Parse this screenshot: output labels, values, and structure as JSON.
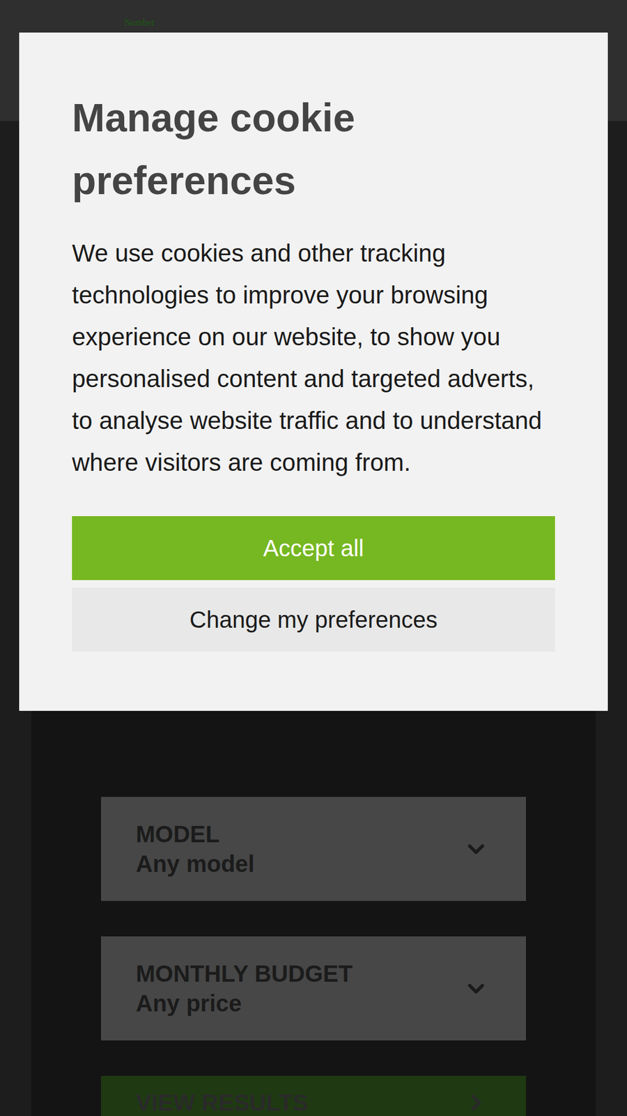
{
  "header": {
    "logo_text": "Number"
  },
  "cookie_dialog": {
    "title": "Manage cookie preferences",
    "body": "We use cookies and other tracking technologies to improve your browsing experience on our website, to show you personalised content and targeted adverts, to analyse website traffic and to understand where visitors are coming from.",
    "buttons": [
      {
        "label": "Accept all",
        "kind": "primary"
      },
      {
        "label": "Change my preferences",
        "kind": "secondary"
      }
    ]
  },
  "search_form": {
    "fields": [
      {
        "label": "MODEL",
        "value": "Any model"
      },
      {
        "label": "MONTHLY BUDGET",
        "value": "Any price"
      }
    ],
    "submit": "VIEW RESULTS"
  }
}
